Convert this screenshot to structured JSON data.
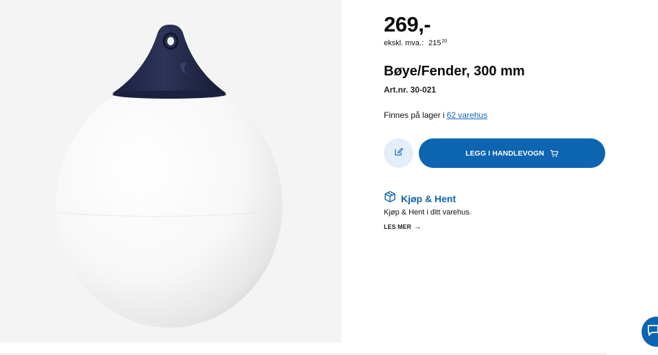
{
  "product": {
    "price": "269,-",
    "price_ex_vat_label": "ekskl. mva.:",
    "price_ex_vat_main": "215",
    "price_ex_vat_cents": "20",
    "title": "Bøye/Fender, 300 mm",
    "article_number": "Art.nr. 30-021",
    "image_icon": "buoy-fender-image"
  },
  "stock": {
    "text": "Finnes på lager i",
    "link": "62 varehus"
  },
  "actions": {
    "edit_icon": "edit-icon",
    "add_to_cart_label": "LEGG I HANDLEVOGN",
    "cart_icon": "shopping-cart-icon"
  },
  "pickup": {
    "icon": "box-icon",
    "title": "Kjøp & Hent",
    "description": "Kjøp & Hent i ditt varehus.",
    "read_more": "LES MER",
    "arrow": "→"
  },
  "chat": {
    "icon": "chat-icon"
  },
  "colors": {
    "accent": "#0d64b0",
    "edit_bg": "#e3eef8",
    "link": "#1366b3",
    "image_bg": "#f4f4f4",
    "buoy_cap": "#23294a"
  }
}
